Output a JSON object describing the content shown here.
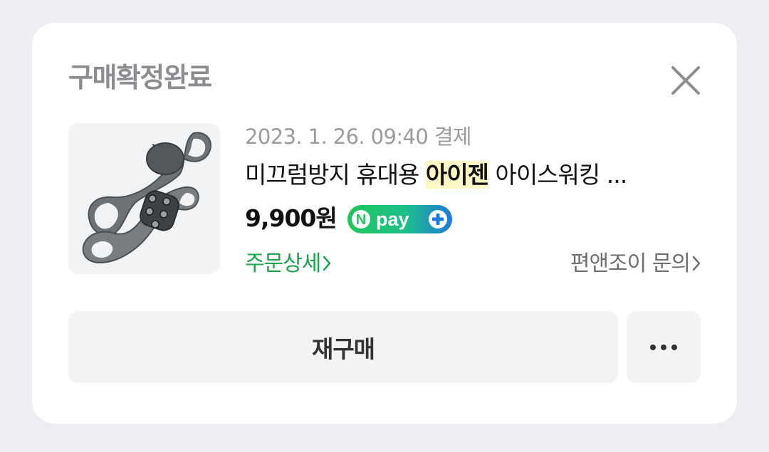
{
  "card": {
    "status_title": "구매확정완료",
    "close_icon": "close-icon"
  },
  "product": {
    "image_icon": "ice-cleat-product-image",
    "order_date": "2023. 1. 26. 09:40 결제",
    "name_prefix": "미끄럼방지 휴대용 ",
    "name_highlight": "아이젠",
    "name_suffix": " 아이스워킹 ...",
    "price": "9,900원",
    "pay_badge": {
      "text": "pay",
      "n_letter": "N",
      "colors": {
        "start": "#1fc65a",
        "end": "#1f7bdc"
      }
    }
  },
  "links": {
    "order_detail": "주문상세",
    "inquiry": "편앤조이 문의"
  },
  "actions": {
    "rebuy_label": "재구매",
    "more_icon": "more-horizontal-icon"
  },
  "colors": {
    "accent_green": "#1aa34a",
    "highlight": "#fff8c4",
    "background": "#eceef2"
  }
}
